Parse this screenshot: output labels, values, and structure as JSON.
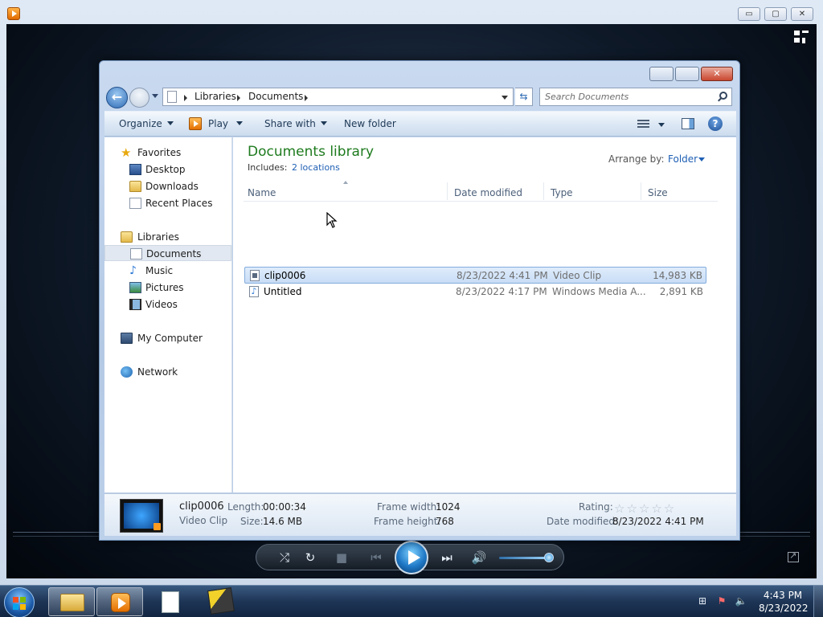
{
  "player": {
    "title_icon": "media-player-icon",
    "caption": {
      "minimize": "▭",
      "maximize": "▢",
      "close": "✕"
    }
  },
  "explorer": {
    "address": {
      "crumbs": [
        "Libraries",
        "Documents"
      ]
    },
    "search_placeholder": "Search Documents",
    "toolbar": {
      "organize": "Organize",
      "play": "Play",
      "share_with": "Share with",
      "new_folder": "New folder",
      "help": "?"
    },
    "nav": {
      "favorites": "Favorites",
      "desktop": "Desktop",
      "downloads": "Downloads",
      "recent_places": "Recent Places",
      "libraries": "Libraries",
      "documents": "Documents",
      "music": "Music",
      "pictures": "Pictures",
      "videos": "Videos",
      "my_computer": "My Computer",
      "network": "Network"
    },
    "library": {
      "title": "Documents library",
      "includes_label": "Includes:",
      "includes_link": "2 locations",
      "arrange_label": "Arrange by:",
      "arrange_value": "Folder"
    },
    "columns": {
      "name": "Name",
      "date_modified": "Date modified",
      "type": "Type",
      "size": "Size"
    },
    "files": [
      {
        "name": "clip0006",
        "date": "8/23/2022 4:41 PM",
        "type": "Video Clip",
        "size": "14,983 KB"
      },
      {
        "name": "Untitled",
        "date": "8/23/2022 4:17 PM",
        "type": "Windows Media A...",
        "size": "2,891 KB"
      }
    ],
    "details": {
      "name": "clip0006",
      "kind": "Video Clip",
      "length_label": "Length:",
      "length_value": "00:00:34",
      "size_label": "Size:",
      "size_value": "14.6 MB",
      "frame_width_label": "Frame width:",
      "frame_width_value": "1024",
      "frame_height_label": "Frame height:",
      "frame_height_value": "768",
      "rating_label": "Rating:",
      "rating_stars": "☆☆☆☆☆",
      "date_modified_label": "Date modified:",
      "date_modified_value": "8/23/2022 4:41 PM"
    }
  },
  "taskbar": {
    "time": "4:43 PM",
    "date": "8/23/2022"
  }
}
